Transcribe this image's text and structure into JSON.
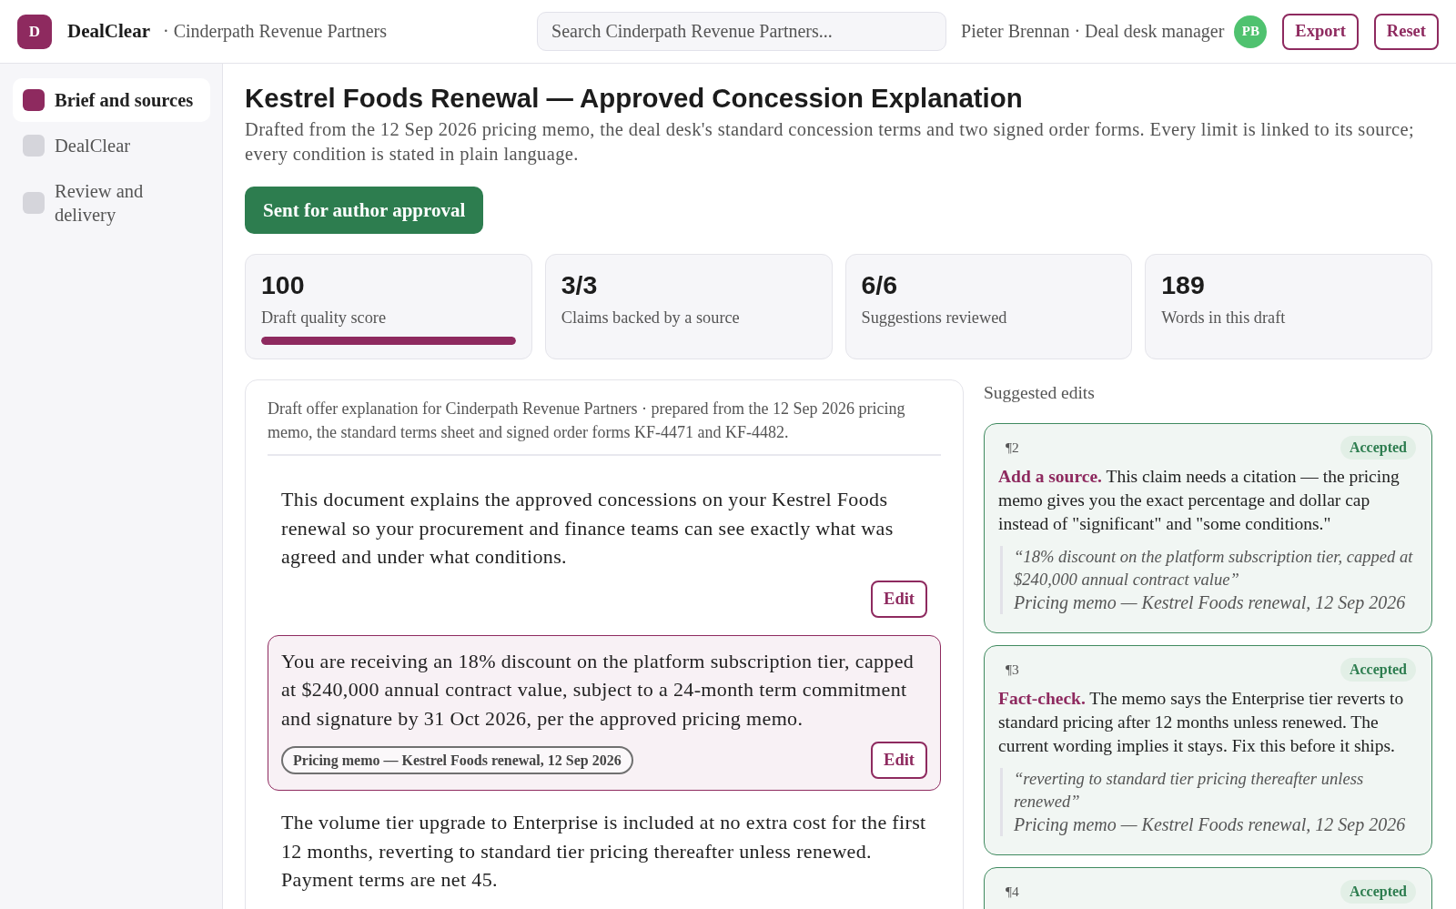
{
  "app": {
    "logo_letter": "D",
    "name": "DealClear",
    "workspace": "· Cinderpath Revenue Partners"
  },
  "search": {
    "placeholder": "Search Cinderpath Revenue Partners..."
  },
  "user": {
    "label": "Pieter Brennan · Deal desk manager",
    "initials": "PB"
  },
  "header_buttons": [
    "Export",
    "Reset"
  ],
  "sidebar": {
    "items": [
      {
        "label": "Brief and sources",
        "selected": true
      },
      {
        "label": "DealClear",
        "selected": false
      },
      {
        "label": "Review and delivery",
        "selected": false
      }
    ]
  },
  "page": {
    "title": "Kestrel Foods Renewal — Approved Concession Explanation",
    "description": "Drafted from the 12 Sep 2026 pricing memo, the deal desk's standard concession terms and two signed order forms. Every limit is linked to its source; every condition is stated in plain language.",
    "status_button": "Sent for author approval"
  },
  "stats": [
    {
      "value": "100",
      "label": "Draft quality score",
      "level": 1
    },
    {
      "value": "3/3",
      "label": "Claims backed by a source"
    },
    {
      "value": "6/6",
      "label": "Suggestions reviewed"
    },
    {
      "value": "189",
      "label": "Words in this draft"
    }
  ],
  "draft": {
    "header": "Draft offer explanation for Cinderpath Revenue Partners · prepared from the 12 Sep 2026 pricing memo, the standard terms sheet and signed order forms KF-4471 and KF-4482.",
    "paragraphs": [
      {
        "text": "This document explains the approved concessions on your Kestrel Foods renewal so your procurement and finance teams can see exactly what was agreed and under what conditions.",
        "selected": false,
        "edit": "Edit"
      },
      {
        "text": "You are receiving an 18% discount on the platform subscription tier, capped at $240,000 annual contract value, subject to a 24-month term commitment and signature by 31 Oct 2026, per the approved pricing memo.",
        "selected": true,
        "source": "Pricing memo — Kestrel Foods renewal, 12 Sep 2026",
        "edit": "Edit"
      },
      {
        "text": "The volume tier upgrade to Enterprise is included at no extra cost for the first 12 months, reverting to standard tier pricing thereafter unless renewed. Payment terms are net 45.",
        "selected": false
      }
    ]
  },
  "suggestions": {
    "title": "Suggested edits",
    "items": [
      {
        "paragraph": "¶2",
        "status": "Accepted",
        "accepted": true,
        "text": "**Add a source.** This claim needs a citation — the pricing memo gives you the exact percentage and dollar cap instead of \"significant\" and \"some conditions.\"",
        "quote": "“18% discount on the platform subscription tier, capped at $240,000 annual contract value”",
        "source": "Pricing memo — Kestrel Foods renewal, 12 Sep 2026"
      },
      {
        "paragraph": "¶3",
        "status": "Accepted",
        "accepted": true,
        "text": "**Fact-check.** The memo says the Enterprise tier reverts to standard pricing after 12 months unless renewed. The current wording implies it stays. Fix this before it ships.",
        "quote": "“reverting to standard tier pricing thereafter unless renewed”",
        "source": "Pricing memo — Kestrel Foods renewal, 12 Sep 2026"
      },
      {
        "paragraph": "¶4",
        "status": "Accepted",
        "accepted": true
      }
    ]
  }
}
